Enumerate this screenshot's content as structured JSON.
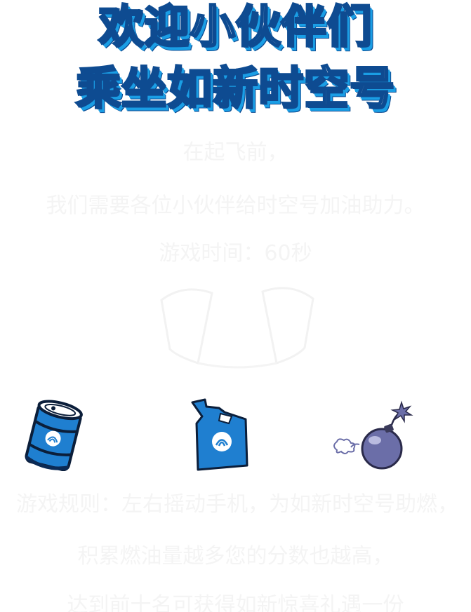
{
  "header": {
    "title_line1": "欢迎小伙伴们",
    "title_line2": "乘坐如新时空号"
  },
  "intro": {
    "line1": "在起飞前，",
    "line2": "我们需要各位小伙伴给时空号加油助力。",
    "line3": "游戏时间：60秒"
  },
  "items": [
    {
      "icon": "oil-barrel-icon"
    },
    {
      "icon": "fuel-canister-icon"
    },
    {
      "icon": "bomb-icon"
    }
  ],
  "rules": {
    "line1": "游戏规则：左右摇动手机，为如新时空号助燃，",
    "line2": "积累燃油量越多您的分数也越高，",
    "line3": "达到前十名可获得如新惊喜礼遇一份"
  },
  "colors": {
    "title_fill": "#ffffff",
    "title_stroke": "#0e4b91",
    "title_shadow": "#1a9ee5",
    "barrel": "#1f7fd0",
    "bomb": "#6b6ea8"
  }
}
